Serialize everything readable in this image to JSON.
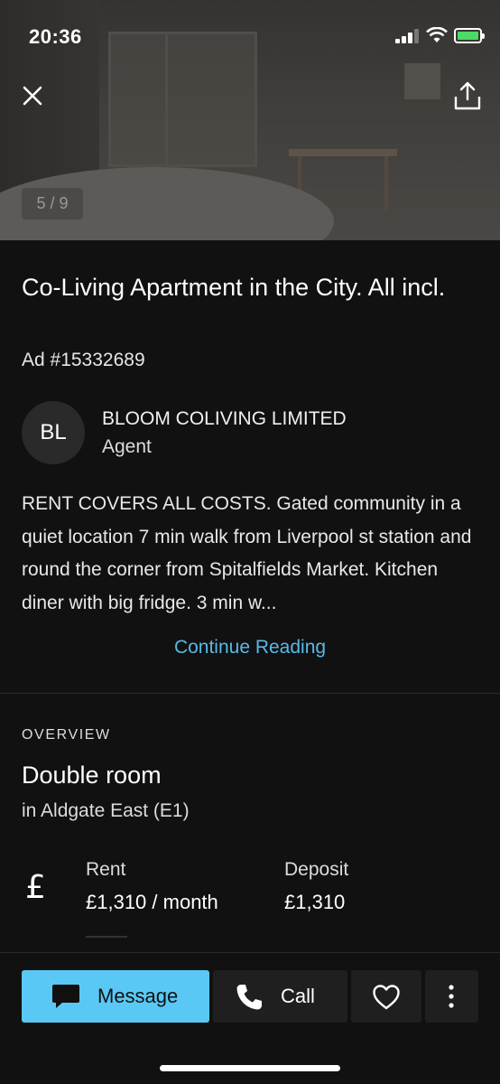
{
  "status_bar": {
    "time": "20:36"
  },
  "gallery": {
    "counter": "5 / 9"
  },
  "listing": {
    "title": "Co-Living Apartment in the City. All incl.",
    "ad_id": "Ad #15332689",
    "description": "RENT COVERS ALL COSTS. Gated community in a quiet location 7 min walk from Liverpool st station and round the corner from Spitalfields Market. Kitchen diner with big fridge. 3 min w...",
    "continue_label": "Continue Reading"
  },
  "agent": {
    "initials": "BL",
    "name": "BLOOM COLIVING LIMITED",
    "role": "Agent"
  },
  "overview": {
    "label": "OVERVIEW",
    "room_type": "Double room",
    "location": "in Aldgate East (E1)",
    "currency_symbol": "£",
    "rent_label": "Rent",
    "rent_value": "£1,310 / month",
    "deposit_label": "Deposit",
    "deposit_value": "£1,310"
  },
  "actions": {
    "message_label": "Message",
    "call_label": "Call"
  },
  "colors": {
    "accent": "#5ac8f5",
    "link": "#5ab8e6",
    "background": "#111111",
    "battery": "#4cd964"
  }
}
